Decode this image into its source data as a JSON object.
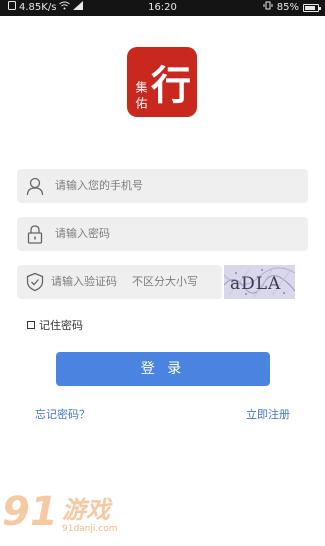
{
  "status_bar": {
    "network_speed": "4.85K/s",
    "time": "16:20",
    "battery_percent": "85%",
    "battery_level": 0.85
  },
  "logo": {
    "main_char": "行",
    "side_text": "集 佑"
  },
  "form": {
    "phone_placeholder": "请输入您的手机号",
    "password_placeholder": "请输入密码",
    "captcha_placeholder": "请输入验证码",
    "captcha_hint": "不区分大小写",
    "captcha_text": "aDLA",
    "remember_label": "记住密码",
    "remember_checked": false,
    "login_label": "登 录",
    "forgot_label": "忘记密码？",
    "register_label": "立即注册"
  },
  "watermark": {
    "number": "91",
    "title": "游戏",
    "url": "91danji.com"
  },
  "colors": {
    "primary": "#4a84e0",
    "link": "#3f76c9",
    "logo_bg": "#c8281e",
    "field_bg": "#efefef"
  }
}
